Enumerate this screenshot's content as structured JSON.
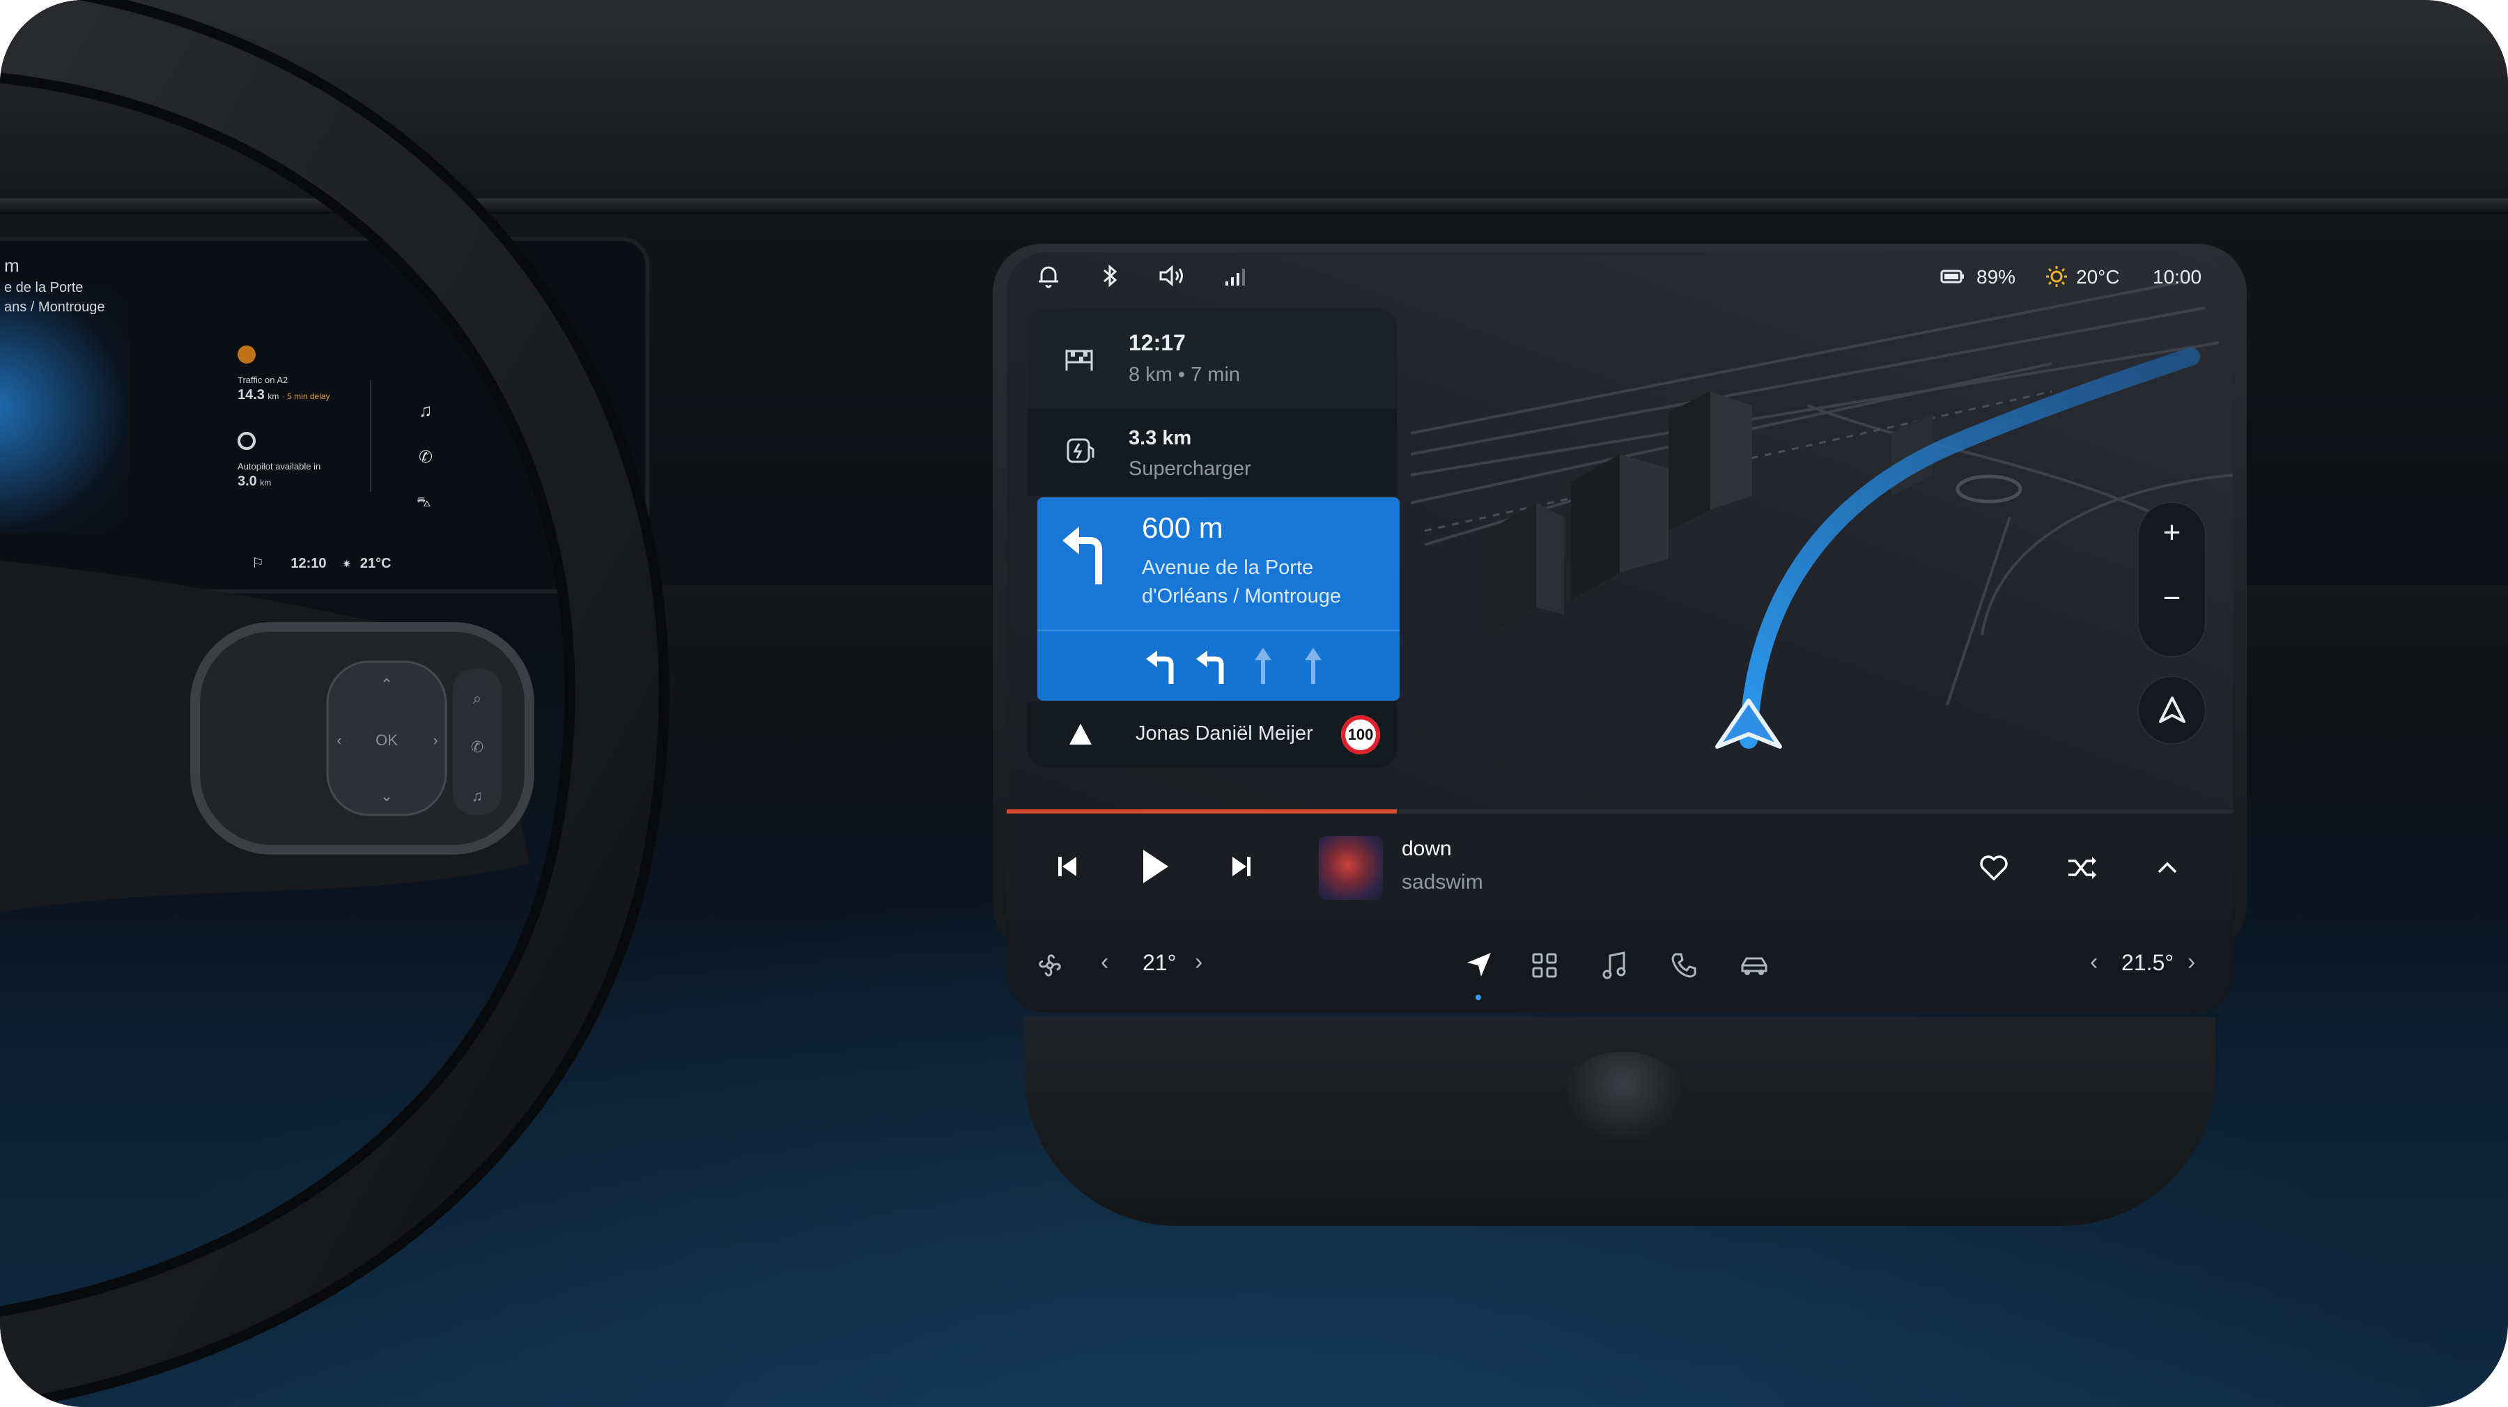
{
  "status_bar": {
    "battery": "89%",
    "weather": "20°C",
    "time": "10:00",
    "icons": [
      "bell-icon",
      "bluetooth-icon",
      "volume-icon",
      "signal-icon",
      "battery-icon",
      "sun-icon"
    ]
  },
  "navigation": {
    "arrival": {
      "time": "12:17",
      "detail": "8 km • 7 min"
    },
    "charger": {
      "distance": "3.3 km",
      "name": "Supercharger"
    },
    "maneuver": {
      "distance": "600 m",
      "street_line1": "Avenue de la Porte",
      "street_line2": "d'Orléans / Montrouge"
    },
    "current_road": {
      "name": "Jonas Daniël Meijer",
      "speed_limit": "100"
    },
    "zoom_in": "+",
    "zoom_out": "−"
  },
  "media": {
    "title": "down",
    "artist": "sadswim"
  },
  "climate": {
    "driver_temp": "21°",
    "passenger_temp": "21.5°"
  },
  "dock": {
    "items": [
      "navigation-icon",
      "apps-icon",
      "music-icon",
      "phone-icon",
      "car-icon"
    ],
    "active": "navigation-icon"
  },
  "cluster": {
    "dest_partial_1": "m",
    "dest_partial_2": "e de la Porte",
    "dest_partial_3": "ans / Montrouge",
    "traffic_label": "Traffic on A2",
    "traffic_value": "14.3",
    "traffic_unit": "km",
    "traffic_delay": "· 5 min delay",
    "autopilot_label": "Autopilot available in",
    "autopilot_value": "3.0",
    "autopilot_unit": "km",
    "time": "12:10",
    "temp": "21°C"
  },
  "colors": {
    "accent_blue": "#1776d6",
    "panel_dark": "#171b21",
    "route_blue": "#34a0f0",
    "speed_red": "#e0202a"
  }
}
